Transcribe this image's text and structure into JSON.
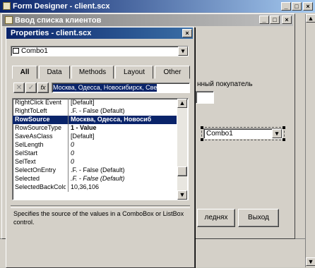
{
  "app": {
    "title": "Form Designer - client.scx",
    "colors": {
      "titlebar": "#0a246a",
      "titlebar_gradient_end": "#a6caf0",
      "selection": "#0a246a",
      "desktop": "#c9c7bf"
    }
  },
  "form": {
    "title": "Ввод списка клиентов",
    "label_customer": "нный покупатель",
    "combo_value": "Combo1",
    "btn_last": "леднях",
    "btn_exit": "Выход"
  },
  "props": {
    "title": "Properties - client.scx",
    "object_select": "Combo1",
    "tabs": [
      "All",
      "Data",
      "Methods",
      "Layout",
      "Other"
    ],
    "active_tab": "All",
    "edit_value": "Москва, Одесса, Новосибирск, Све",
    "rows": [
      {
        "name": "RightClick Event",
        "value": "[Default]"
      },
      {
        "name": "RightToLeft",
        "value": ".F. - False (Default)"
      },
      {
        "name": "RowSource",
        "value": "Москва, Одесса, Новосиб"
      },
      {
        "name": "RowSourceType",
        "value": "1 - Value"
      },
      {
        "name": "SaveAsClass",
        "value": "[Default]"
      },
      {
        "name": "SelLength",
        "value": "0"
      },
      {
        "name": "SelStart",
        "value": "0"
      },
      {
        "name": "SelText",
        "value": "0"
      },
      {
        "name": "SelectOnEntry",
        "value": ".F. - False (Default)"
      },
      {
        "name": "Selected",
        "value": ".F. - False (Default)"
      },
      {
        "name": "SelectedBackColor",
        "value": "10,36,106"
      }
    ],
    "description": "Specifies the source of the values in a ComboBox or ListBox control."
  }
}
